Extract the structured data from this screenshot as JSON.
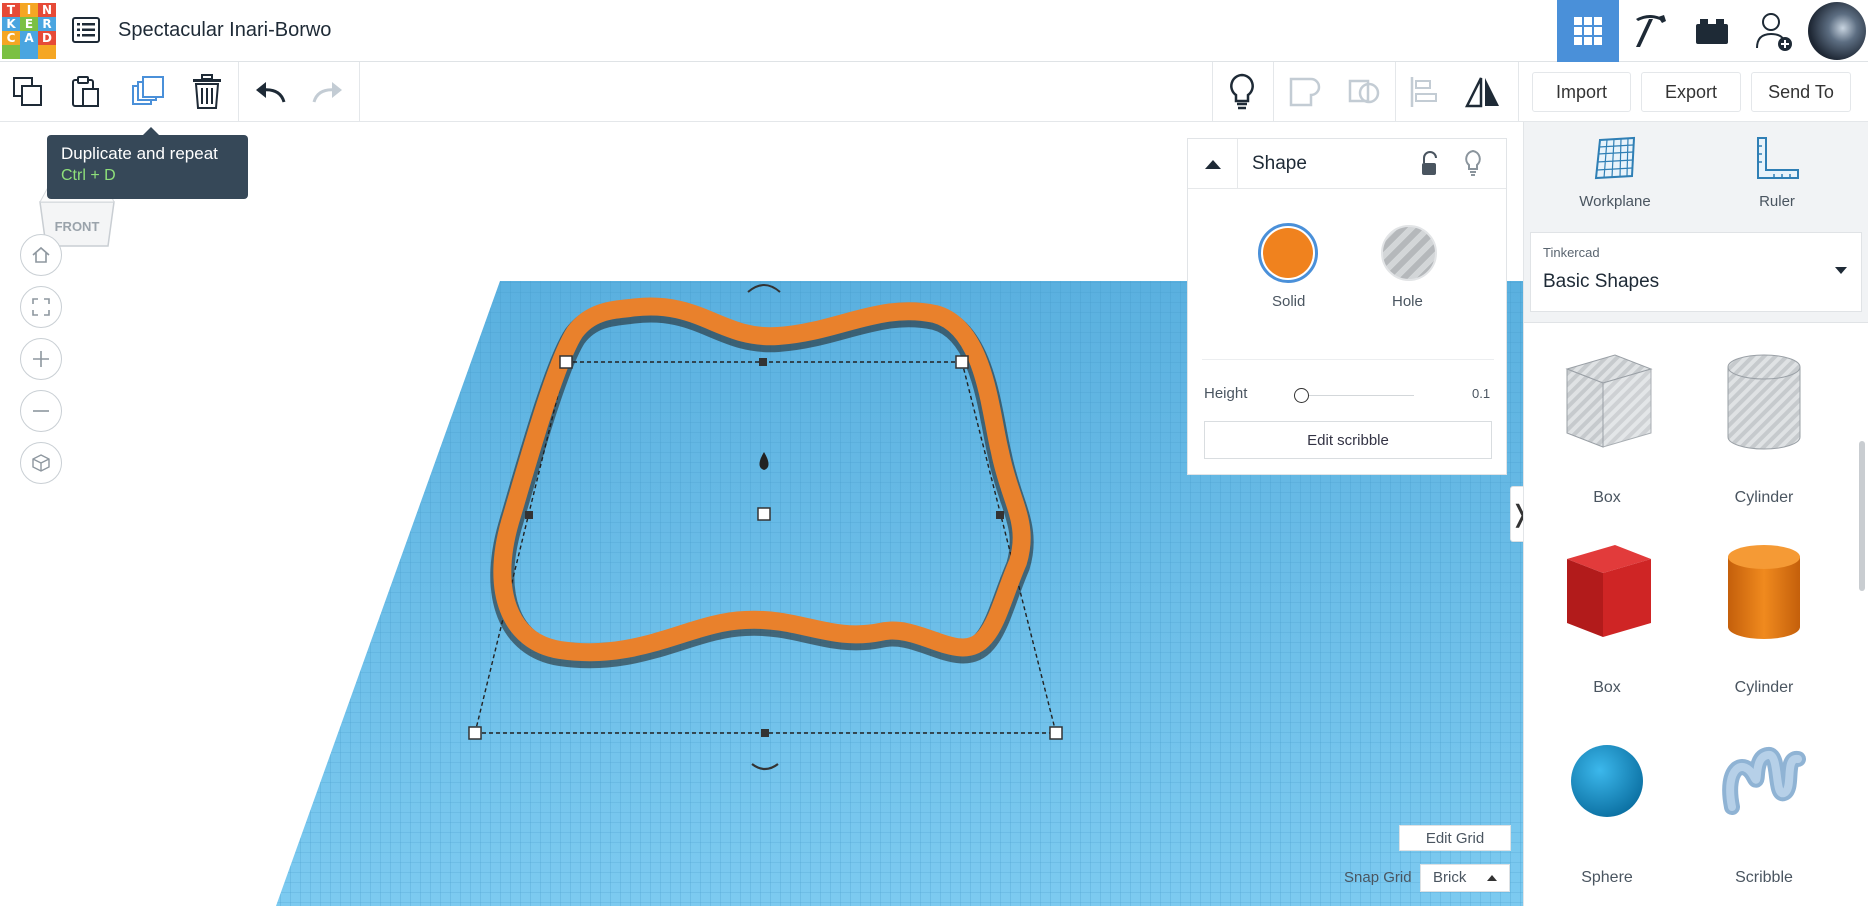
{
  "app": {
    "logo_letters": [
      "T",
      "I",
      "N",
      "K",
      "E",
      "R",
      "C",
      "A",
      "D"
    ],
    "design_title": "Spectacular Inari-Borwo"
  },
  "tooltip": {
    "title": "Duplicate and repeat",
    "shortcut": "Ctrl + D"
  },
  "toolbar": {
    "import_label": "Import",
    "export_label": "Export",
    "send_to_label": "Send To"
  },
  "view_cube": {
    "face_label": "FRONT"
  },
  "shape_panel": {
    "title": "Shape",
    "solid_label": "Solid",
    "hole_label": "Hole",
    "height_label": "Height",
    "height_value": "0.1",
    "edit_button": "Edit scribble",
    "solid_color": "#f0821e"
  },
  "sidebar": {
    "workplane_label": "Workplane",
    "ruler_label": "Ruler",
    "library_group": "Tinkercad",
    "library_name": "Basic Shapes",
    "shapes": [
      {
        "label": "Box",
        "icon": "box-hole-icon"
      },
      {
        "label": "Cylinder",
        "icon": "cylinder-hole-icon"
      },
      {
        "label": "Box",
        "icon": "box-red-icon"
      },
      {
        "label": "Cylinder",
        "icon": "cylinder-orange-icon"
      },
      {
        "label": "Sphere",
        "icon": "sphere-blue-icon"
      },
      {
        "label": "Scribble",
        "icon": "scribble-icon"
      }
    ]
  },
  "grid_controls": {
    "edit_grid_label": "Edit Grid",
    "snap_grid_label": "Snap Grid",
    "snap_value": "Brick"
  },
  "colors": {
    "workplane": "#5cb3e2",
    "accent_blue": "#4a90d9",
    "shape_orange": "#f0821e"
  }
}
